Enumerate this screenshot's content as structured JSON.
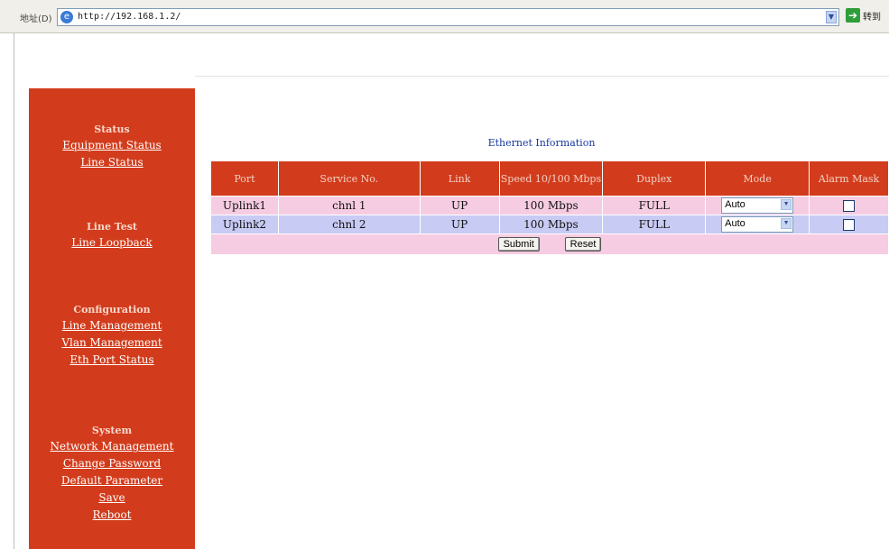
{
  "browser": {
    "address_label": "地址(D)",
    "url": "http://192.168.1.2/",
    "go_label": "转到",
    "dropdown_icon": "chevron-down-icon"
  },
  "sidebar": {
    "sections": [
      {
        "heading": "Status",
        "links": [
          "Equipment Status",
          "Line Status"
        ]
      },
      {
        "heading": "Line Test",
        "links": [
          "Line Loopback"
        ]
      },
      {
        "heading": "Configuration",
        "links": [
          "Line Management",
          "Vlan Management",
          "Eth Port Status"
        ]
      },
      {
        "heading": "System",
        "links": [
          "Network Management",
          "Change Password",
          "Default Parameter",
          "Save",
          "Reboot"
        ]
      }
    ]
  },
  "main": {
    "title": "Ethernet Information",
    "columns": [
      "Port",
      "Service No.",
      "Link",
      "Speed 10/100 Mbps",
      "Duplex",
      "Mode",
      "Alarm Mask"
    ],
    "rows": [
      {
        "port": "Uplink1",
        "service": "chnl 1",
        "link": "UP",
        "speed": "100 Mbps",
        "duplex": "FULL",
        "mode": "Auto",
        "alarm_mask": false
      },
      {
        "port": "Uplink2",
        "service": "chnl 2",
        "link": "UP",
        "speed": "100 Mbps",
        "duplex": "FULL",
        "mode": "Auto",
        "alarm_mask": false
      }
    ],
    "submit_label": "Submit",
    "reset_label": "Reset"
  },
  "colors": {
    "sidebar_bg": "#d23c1c",
    "header_bg": "#d23c1c",
    "row_pink": "#f6cce2",
    "row_blue": "#c8cbf3"
  }
}
